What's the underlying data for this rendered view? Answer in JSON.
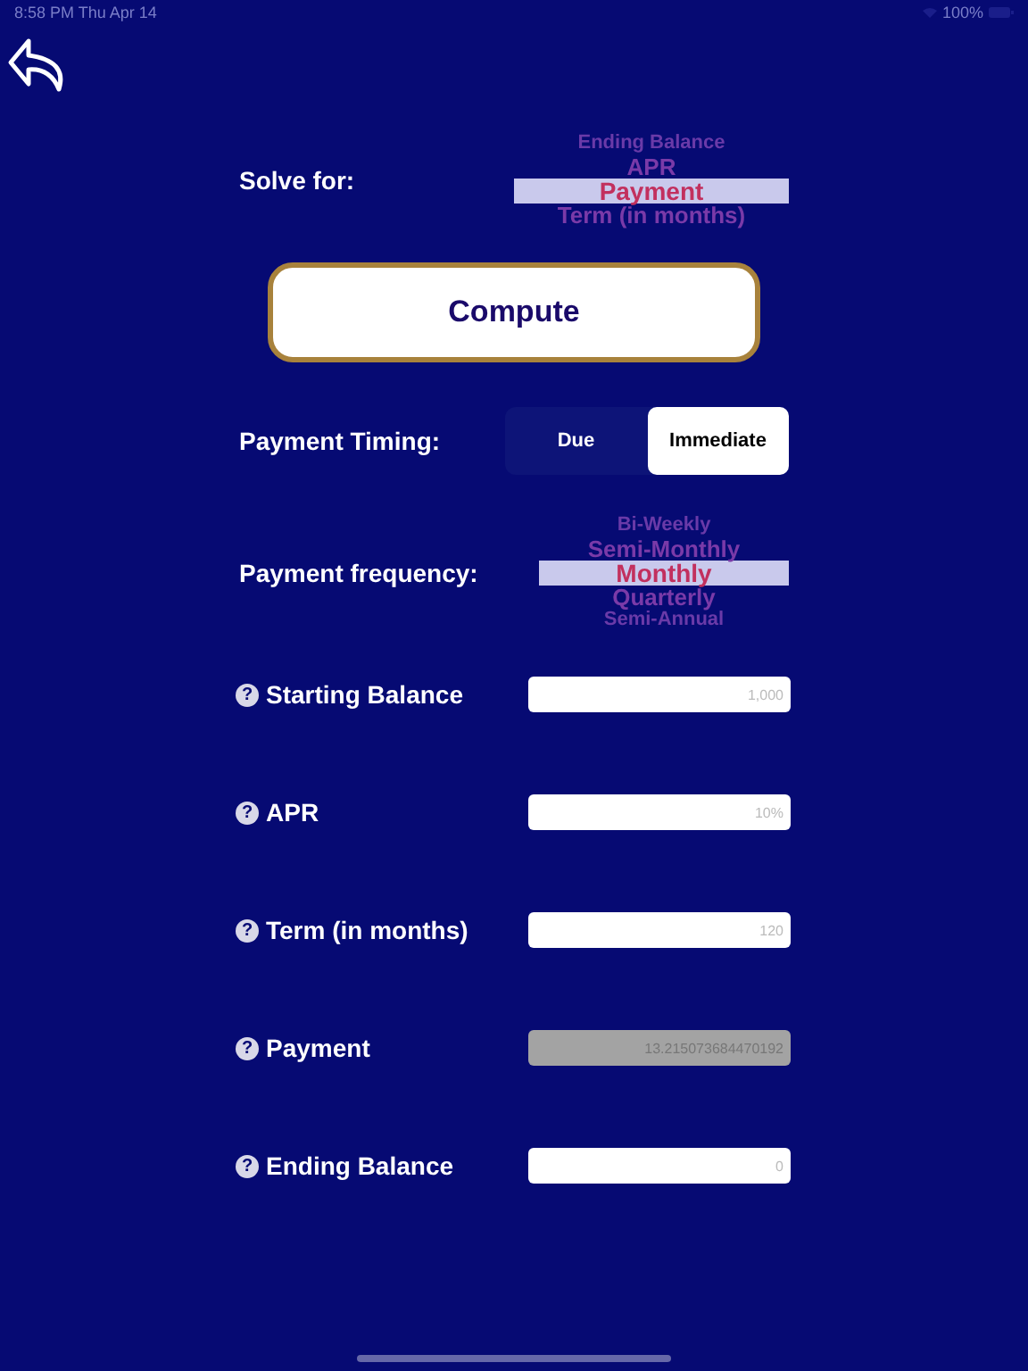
{
  "status_bar": {
    "time": "8:58 PM  Thu Apr 14",
    "battery": "100%"
  },
  "solve_for": {
    "label": "Solve for:",
    "options": [
      {
        "label": "Ending Balance",
        "selected": false
      },
      {
        "label": "APR",
        "selected": false
      },
      {
        "label": "Payment",
        "selected": true
      },
      {
        "label": "Term (in months)",
        "selected": false
      }
    ]
  },
  "compute_button": "Compute",
  "payment_timing": {
    "label": "Payment Timing:",
    "options": [
      {
        "label": "Due",
        "selected": false
      },
      {
        "label": "Immediate",
        "selected": true
      }
    ]
  },
  "payment_frequency": {
    "label": "Payment frequency:",
    "options": [
      {
        "label": "Bi-Weekly",
        "selected": false
      },
      {
        "label": "Semi-Monthly",
        "selected": false
      },
      {
        "label": "Monthly",
        "selected": true
      },
      {
        "label": "Quarterly",
        "selected": false
      },
      {
        "label": "Semi-Annual",
        "selected": false
      }
    ]
  },
  "fields": [
    {
      "help": "?",
      "label": "Starting Balance",
      "placeholder": "1,000",
      "disabled": false
    },
    {
      "help": "?",
      "label": "APR",
      "placeholder": "10%",
      "disabled": false
    },
    {
      "help": "?",
      "label": "Term (in months)",
      "placeholder": "120",
      "disabled": false
    },
    {
      "help": "?",
      "label": "Payment",
      "value": "13.215073684470192",
      "disabled": true
    },
    {
      "help": "?",
      "label": "Ending Balance",
      "placeholder": "0",
      "disabled": false
    }
  ]
}
